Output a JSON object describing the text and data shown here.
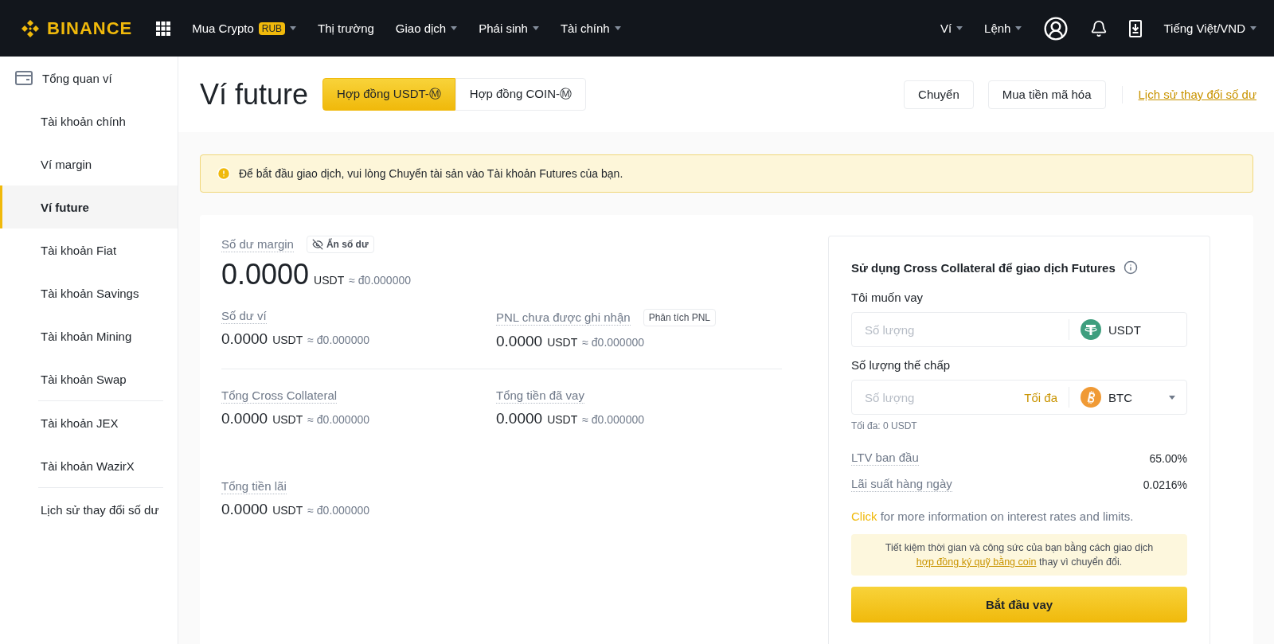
{
  "topbar": {
    "logo": "BINANCE",
    "menu": [
      {
        "label": "Mua Crypto",
        "badge": "RUB",
        "dropdown": true
      },
      {
        "label": "Thị trường",
        "dropdown": false
      },
      {
        "label": "Giao dịch",
        "dropdown": true
      },
      {
        "label": "Phái sinh",
        "dropdown": true
      },
      {
        "label": "Tài chính",
        "dropdown": true
      }
    ],
    "right_menu": [
      {
        "label": "Ví",
        "dropdown": true
      },
      {
        "label": "Lệnh",
        "dropdown": true
      }
    ],
    "language": "Tiếng Việt/VND"
  },
  "sidebar": {
    "groups": [
      [
        {
          "label": "Tổng quan ví",
          "kind": "overview",
          "selected": false
        },
        {
          "label": "Tài khoản chính",
          "kind": "item",
          "selected": false
        },
        {
          "label": "Ví margin",
          "kind": "item",
          "selected": false
        },
        {
          "label": "Ví future",
          "kind": "item",
          "selected": true
        },
        {
          "label": "Tài khoản Fiat",
          "kind": "item",
          "selected": false
        },
        {
          "label": "Tài khoản Savings",
          "kind": "item",
          "selected": false
        },
        {
          "label": "Tài khoản Mining",
          "kind": "item",
          "selected": false
        },
        {
          "label": "Tài khoản Swap",
          "kind": "item",
          "selected": false
        }
      ],
      [
        {
          "label": "Tài khoản JEX",
          "kind": "item",
          "selected": false
        },
        {
          "label": "Tài khoản WazirX",
          "kind": "item",
          "selected": false
        }
      ],
      [
        {
          "label": "Lịch sử thay đổi số dư",
          "kind": "item",
          "selected": false
        }
      ]
    ]
  },
  "header": {
    "title": "Ví future",
    "tabs": [
      {
        "label": "Hợp đồng USDT-Ⓜ",
        "selected": true
      },
      {
        "label": "Hợp đồng COIN-Ⓜ",
        "selected": false
      }
    ],
    "buttons": [
      "Chuyển",
      "Mua tiền mã hóa"
    ],
    "link": "Lịch sử thay đổi số dư"
  },
  "alert": "Để bắt đầu giao dịch, vui lòng Chuyển tài sản vào Tài khoản Futures của bạn.",
  "balance": {
    "label": "Số dư margin",
    "hide_button": "Ẩn số dư",
    "value": "0.0000",
    "unit": "USDT",
    "approx": "≈ đ0.000000",
    "stats": [
      {
        "label": "Số dư ví",
        "value": "0.0000",
        "unit": "USDT",
        "approx": "≈ đ0.000000"
      },
      {
        "label": "PNL chưa được ghi nhận",
        "button": "Phân tích PNL",
        "value": "0.0000",
        "unit": "USDT",
        "approx": "≈ đ0.000000"
      },
      {
        "label": "Tổng Cross Collateral",
        "value": "0.0000",
        "unit": "USDT",
        "approx": "≈ đ0.000000"
      },
      {
        "label": "Tổng tiền đã vay",
        "value": "0.0000",
        "unit": "USDT",
        "approx": "≈ đ0.000000"
      },
      {
        "label": "Tổng tiền lãi",
        "value": "0.0000",
        "unit": "USDT",
        "approx": "≈ đ0.000000"
      }
    ]
  },
  "borrow": {
    "title": "Sử dụng Cross Collateral để giao dịch Futures",
    "fields": [
      {
        "label": "Tôi muốn vay",
        "placeholder": "Số lượng",
        "coin": "USDT",
        "kind": "usdt",
        "dropdown": false
      },
      {
        "label": "Số lượng thế chấp",
        "placeholder": "Số lượng",
        "max_button": "Tối đa",
        "coin": "BTC",
        "kind": "btc",
        "dropdown": true,
        "hint": "Tối đa: 0 USDT"
      }
    ],
    "rates": [
      {
        "label": "LTV ban đầu",
        "value": "65.00%"
      },
      {
        "label": "Lãi suất hàng ngày",
        "value": "0.0216%"
      }
    ],
    "info": {
      "link": "Click",
      "text": "for more information on interest rates and limits."
    },
    "notice": {
      "before": "Tiết kiệm thời gian và công sức của bạn bằng cách giao dịch",
      "link": "hợp đồng ký quỹ bằng coin",
      "after": "thay vì chuyển đổi."
    },
    "submit": "Bắt đầu vay"
  }
}
